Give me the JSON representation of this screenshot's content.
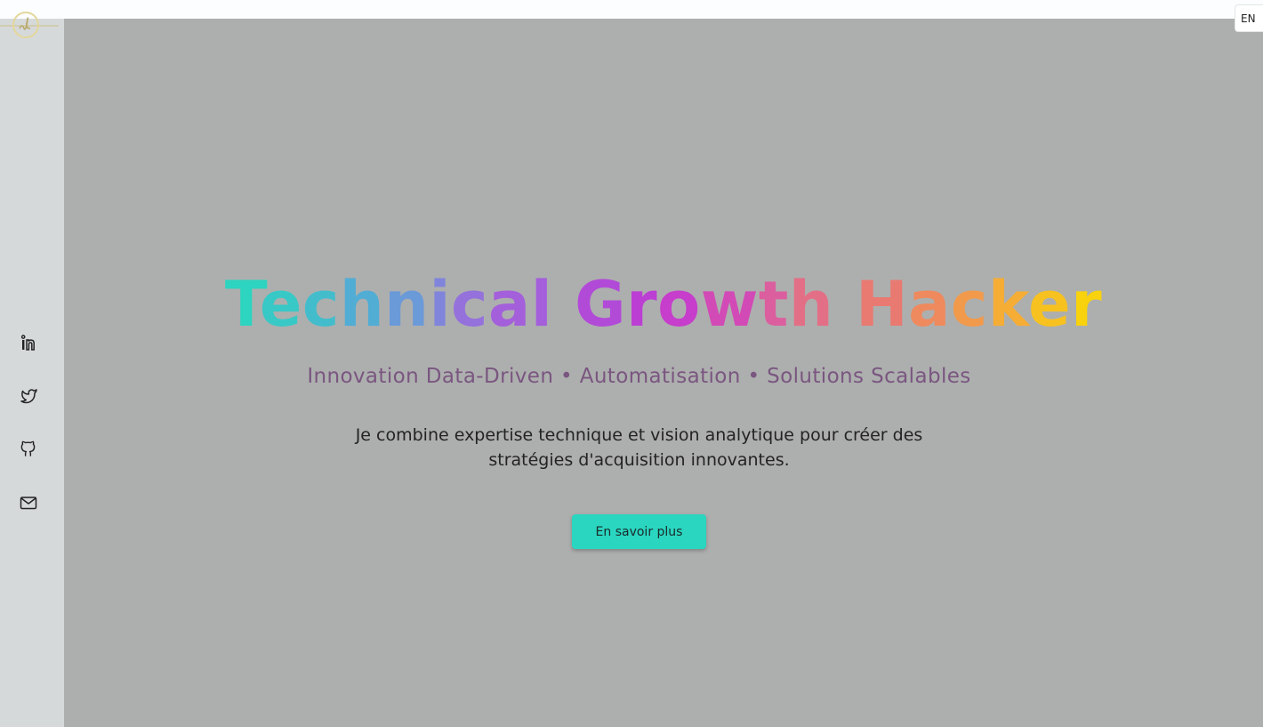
{
  "language": {
    "label": "EN"
  },
  "hero": {
    "title_words": [
      {
        "text": "Technical",
        "colors": [
          "#2dd4bf",
          "#38c9c6",
          "#43bdcc",
          "#52add4",
          "#6b9ad8",
          "#8184db",
          "#9571dc",
          "#a45fdb"
        ]
      },
      {
        "text": "Growth",
        "colors": [
          "#b24ad8",
          "#bc3fd3",
          "#c63ecb",
          "#d24ab6",
          "#db5f9e",
          "#e36f86"
        ]
      },
      {
        "text": "Hacker",
        "colors": [
          "#e97a72",
          "#ee8a5e",
          "#f29a4b",
          "#f5ad36",
          "#f7c120",
          "#f8d20c"
        ]
      }
    ],
    "subtitle": "Innovation Data-Driven • Automatisation • Solutions Scalables",
    "description_line1": "Je combine expertise technique et vision analytique pour créer des",
    "description_line2": "stratégies d'acquisition innovantes.",
    "cta_label": "En savoir plus"
  },
  "social": [
    {
      "name": "linkedin-icon"
    },
    {
      "name": "twitter-icon"
    },
    {
      "name": "github-icon"
    },
    {
      "name": "mail-icon"
    }
  ],
  "colors": {
    "accent": "#2ad6c0",
    "subtitle": "#7a5680",
    "hero_bg": "#adafae",
    "sidebar_bg": "#d6d9da"
  }
}
